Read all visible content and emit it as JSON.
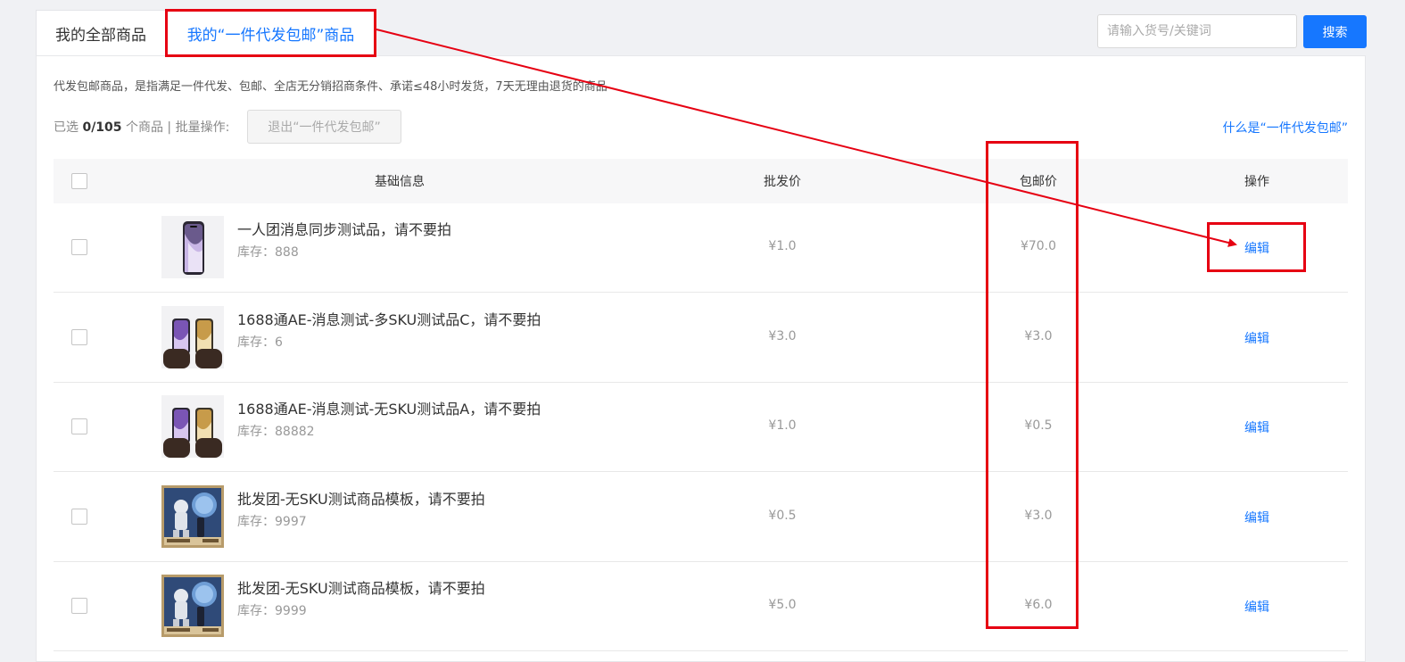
{
  "tabs": {
    "all": "我的全部商品",
    "free_ship": "我的“一件代发包邮”商品"
  },
  "search": {
    "placeholder": "请输入货号/关键词",
    "button": "搜索"
  },
  "description": "代发包邮商品，是指满足一件代发、包邮、全店无分销招商条件、承诺≤48小时发货，7天无理由退货的商品",
  "selection": {
    "prefix": "已选",
    "count": "0/105",
    "suffix": "个商品 | 批量操作:",
    "exit_button": "退出“一件代发包邮”"
  },
  "what_link": "什么是“一件代发包邮”",
  "columns": {
    "info": "基础信息",
    "wholesale": "批发价",
    "shipping": "包邮价",
    "action": "操作"
  },
  "stock_label": "库存：",
  "edit_label": "编辑",
  "rows": [
    {
      "title": "一人团消息同步测试品，请不要拍",
      "stock": "888",
      "wholesale": "¥1.0",
      "shipping": "¥70.0",
      "image": "phone-purple"
    },
    {
      "title": "1688通AE-消息测试-多SKU测试品C，请不要拍",
      "stock": "6",
      "wholesale": "¥3.0",
      "shipping": "¥3.0",
      "image": "phones-in-hands"
    },
    {
      "title": "1688通AE-消息测试-无SKU测试品A，请不要拍",
      "stock": "88882",
      "wholesale": "¥1.0",
      "shipping": "¥0.5",
      "image": "phones-in-hands"
    },
    {
      "title": "批发团-无SKU测试商品模板，请不要拍",
      "stock": "9997",
      "wholesale": "¥0.5",
      "shipping": "¥3.0",
      "image": "astronaut-poster"
    },
    {
      "title": "批发团-无SKU测试商品模板，请不要拍",
      "stock": "9999",
      "wholesale": "¥5.0",
      "shipping": "¥6.0",
      "image": "astronaut-poster"
    }
  ],
  "colors": {
    "accent": "#1677ff",
    "annotation": "#e60012"
  }
}
